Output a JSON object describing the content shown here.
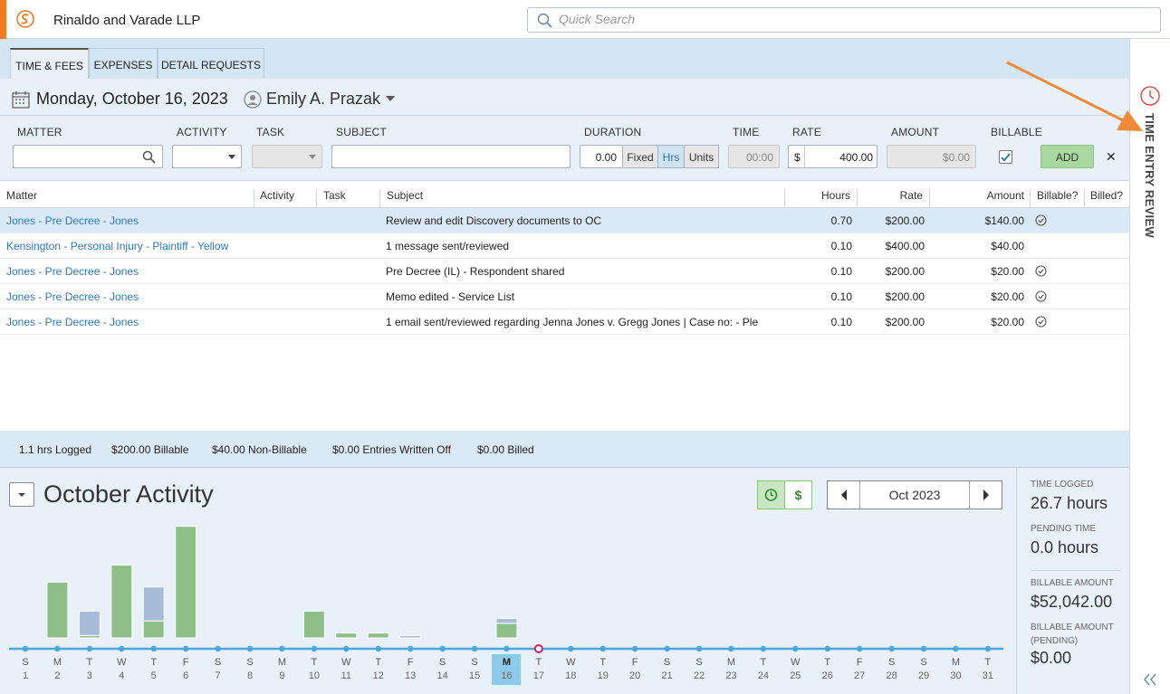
{
  "header": {
    "firm_name": "Rinaldo and Varade LLP",
    "search_placeholder": "Quick Search",
    "accent": "#f47a20"
  },
  "tabs": [
    {
      "label": "TIME & FEES",
      "active": true
    },
    {
      "label": "EXPENSES"
    },
    {
      "label": "DETAIL REQUESTS"
    }
  ],
  "entry": {
    "date": "Monday, October 16, 2023",
    "user": "Emily A. Prazak",
    "labels": {
      "matter": "MATTER",
      "activity": "ACTIVITY",
      "task": "TASK",
      "subject": "SUBJECT",
      "duration": "DURATION",
      "time": "TIME",
      "rate": "RATE",
      "amount": "AMOUNT",
      "billable": "BILLABLE"
    },
    "duration_value": "0.00",
    "duration_modes": [
      "Fixed",
      "Hrs",
      "Units"
    ],
    "time_value": "00:00",
    "rate_symbol": "$",
    "rate_value": "400.00",
    "amount_value": "$0.00",
    "billable_checked": true,
    "add_label": "ADD",
    "close_label": "✕"
  },
  "grid": {
    "columns": [
      "Matter",
      "Activity",
      "Task",
      "Subject",
      "Hours",
      "Rate",
      "Amount",
      "Billable?",
      "Billed?"
    ],
    "rows": [
      {
        "matter": "Jones - Pre Decree - Jones",
        "subject": "Review and edit Discovery documents to OC",
        "hours": "0.70",
        "rate": "$200.00",
        "amount": "$140.00",
        "billable": true
      },
      {
        "matter": "Kensington - Personal Injury - Plaintiff - Yellow",
        "subject": "1 message sent/reviewed",
        "hours": "0.10",
        "rate": "$400.00",
        "amount": "$40.00",
        "billable": false
      },
      {
        "matter": "Jones - Pre Decree - Jones",
        "subject": "Pre Decree (IL) - Respondent shared",
        "hours": "0.10",
        "rate": "$200.00",
        "amount": "$20.00",
        "billable": true
      },
      {
        "matter": "Jones - Pre Decree - Jones",
        "subject": "Memo edited - Service List",
        "hours": "0.10",
        "rate": "$200.00",
        "amount": "$20.00",
        "billable": true
      },
      {
        "matter": "Jones - Pre Decree - Jones",
        "subject": "1 email sent/reviewed regarding Jenna Jones v. Gregg Jones | Case no:  - Ple",
        "hours": "0.10",
        "rate": "$200.00",
        "amount": "$20.00",
        "billable": true
      }
    ]
  },
  "stats": {
    "logged": "1.1 hrs Logged",
    "billable": "$200.00 Billable",
    "nonbillable": "$40.00 Non-Billable",
    "written_off": "$0.00 Entries Written Off",
    "billed": "$0.00 Billed"
  },
  "activity": {
    "title": "October Activity",
    "month": "Oct 2023",
    "dollar_label": "$",
    "summary": [
      {
        "label": "TIME LOGGED",
        "value": "26.7 hours"
      },
      {
        "label": "PENDING TIME",
        "value": "0.0 hours"
      },
      {
        "label": "BILLABLE AMOUNT",
        "value": "$52,042.00"
      },
      {
        "label": "BILLABLE AMOUNT (PENDING)",
        "value": "$0.00"
      }
    ]
  },
  "sidebar": {
    "label": "TIME ENTRY REVIEW"
  },
  "chart_data": {
    "type": "bar",
    "categories": [
      "1",
      "2",
      "3",
      "4",
      "5",
      "6",
      "7",
      "8",
      "9",
      "10",
      "11",
      "12",
      "13",
      "14",
      "15",
      "16",
      "17",
      "18",
      "19",
      "20",
      "21",
      "22",
      "23",
      "24",
      "25",
      "26",
      "27",
      "28",
      "29",
      "30",
      "31"
    ],
    "weekdays": [
      "S",
      "M",
      "T",
      "W",
      "T",
      "F",
      "S",
      "S",
      "M",
      "T",
      "W",
      "T",
      "F",
      "S",
      "S",
      "M",
      "T",
      "W",
      "T",
      "F",
      "S",
      "S",
      "M",
      "T",
      "W",
      "T",
      "F",
      "S",
      "S",
      "M",
      "T"
    ],
    "selected_day": "16",
    "today_day": "17",
    "series": [
      {
        "values": [
          0,
          2.3,
          0.1,
          3.0,
          0.7,
          4.6,
          0,
          0,
          0,
          1.1,
          0.2,
          0.2,
          0,
          0,
          0,
          0.6,
          0,
          0,
          0,
          0,
          0,
          0,
          0,
          0,
          0,
          0,
          0,
          0,
          0,
          0,
          0
        ],
        "color": "#8fbf88"
      },
      {
        "values": [
          0,
          0,
          1.0,
          0,
          1.4,
          0,
          0,
          0,
          0,
          0,
          0,
          0,
          0.1,
          0,
          0,
          0.2,
          0,
          0,
          0,
          0,
          0,
          0,
          0,
          0,
          0,
          0,
          0,
          0,
          0,
          0,
          0
        ],
        "color": "#a8bcd9"
      }
    ],
    "series_colors": {
      "billable": "#8fbf88",
      "pending": "#a8bcd9"
    }
  }
}
